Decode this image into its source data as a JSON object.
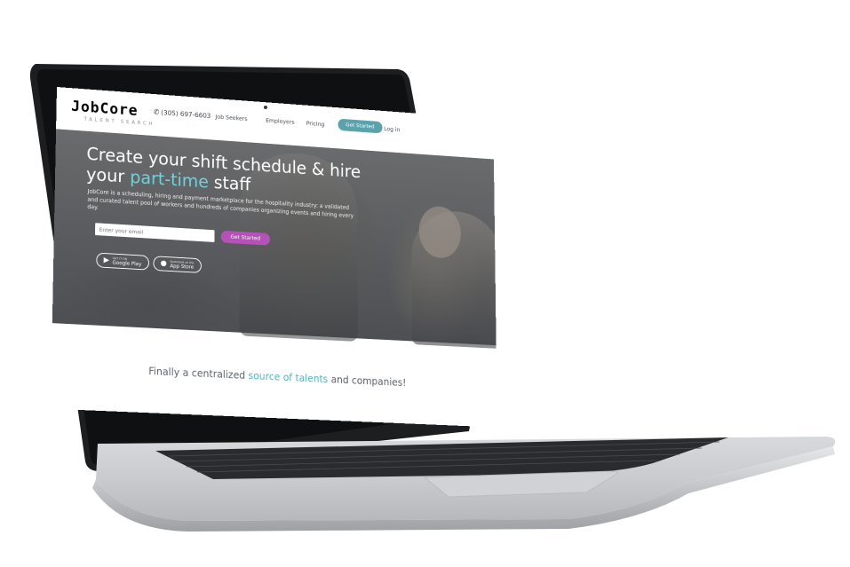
{
  "brand": {
    "logo_text": "JobCore",
    "logo_subtitle": "TALENT SEARCH"
  },
  "nav": {
    "phone": "(305) 697-6603",
    "links": [
      "Job Seekers",
      "Employers",
      "Pricing"
    ],
    "cta_label": "Get Started",
    "login_label": "Log in"
  },
  "hero": {
    "title_line1": "Create your shift schedule & hire",
    "title_pre": "your ",
    "title_accent": "part-time",
    "title_post": " staff",
    "description": "JobCore is a scheduling, hiring and payment marketplace for the hospitality industry: a validated and curated talent pool of workers and hundreds of companies organizing events and hiring every day.",
    "email_placeholder": "Enter your email",
    "cta_label": "Get Started",
    "store_buttons": [
      {
        "small": "GET IT ON",
        "label": "Google Play",
        "icon": "google-play-icon"
      },
      {
        "small": "Download on the",
        "label": "App Store",
        "icon": "apple-icon"
      }
    ]
  },
  "section": {
    "tagline_pre": "Finally a centralized ",
    "tagline_accent": "source of talents",
    "tagline_post": " and companies!"
  },
  "colors": {
    "accent_teal": "#6fd3dc",
    "cta_purple": "#b651b9",
    "nav_cta_teal": "#5aa3ad"
  }
}
